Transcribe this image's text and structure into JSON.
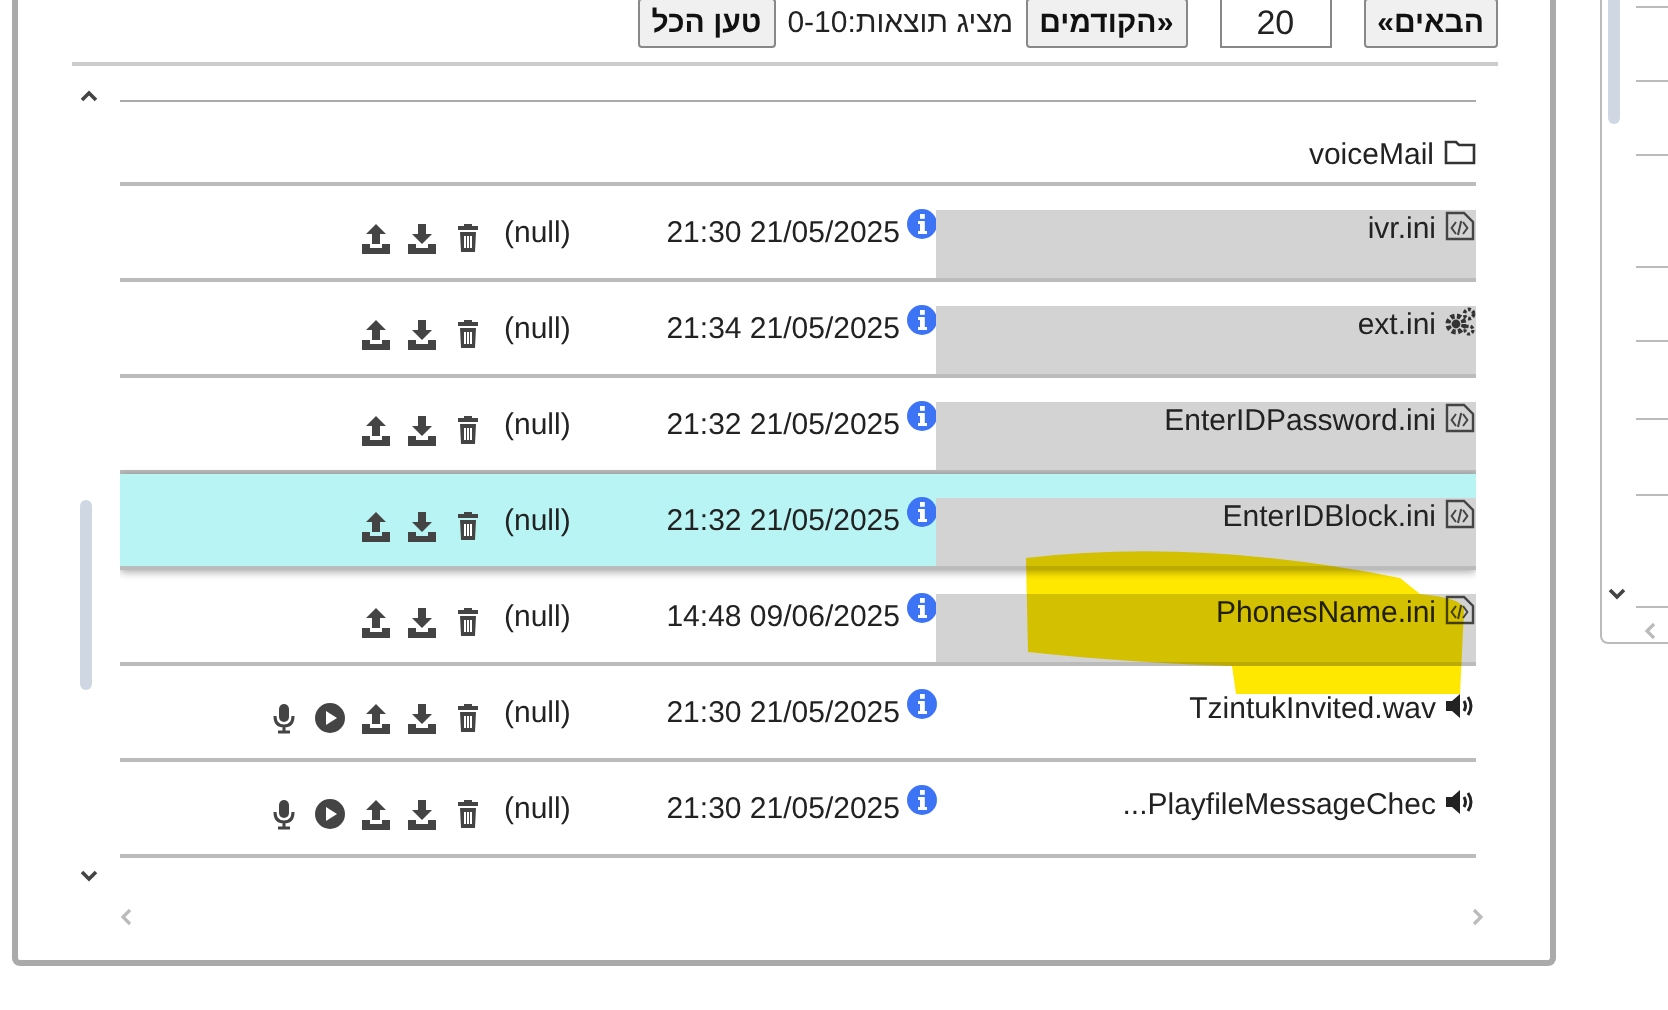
{
  "toolbar": {
    "next_button": "«הבאים",
    "page_size": "20",
    "prev_button": "הקודמים»",
    "results_label": "מציג תוצאות:0-10",
    "load_all_button": "טען הכל"
  },
  "folder": {
    "name": "voiceMail"
  },
  "files": [
    {
      "name": "ivr.ini",
      "kind": "code",
      "modified": "21:30 21/05/2025",
      "owner": "(null)",
      "selected": false
    },
    {
      "name": "ext.ini",
      "kind": "config",
      "modified": "21:34 21/05/2025",
      "owner": "(null)",
      "selected": false
    },
    {
      "name": "EnterIDPassword.ini",
      "kind": "code",
      "modified": "21:32 21/05/2025",
      "owner": "(null)",
      "selected": false
    },
    {
      "name": "EnterIDBlock.ini",
      "kind": "code",
      "modified": "21:32 21/05/2025",
      "owner": "(null)",
      "selected": true
    },
    {
      "name": "PhonesName.ini",
      "kind": "code",
      "modified": "14:48 09/06/2025",
      "owner": "(null)",
      "selected": false
    },
    {
      "name": "TzintukInvited.wav",
      "kind": "audio",
      "modified": "21:30 21/05/2025",
      "owner": "(null)",
      "selected": false
    },
    {
      "name": "...PlayfileMessageChec",
      "kind": "audio",
      "modified": "21:30 21/05/2025",
      "owner": "(null)",
      "selected": false
    }
  ]
}
